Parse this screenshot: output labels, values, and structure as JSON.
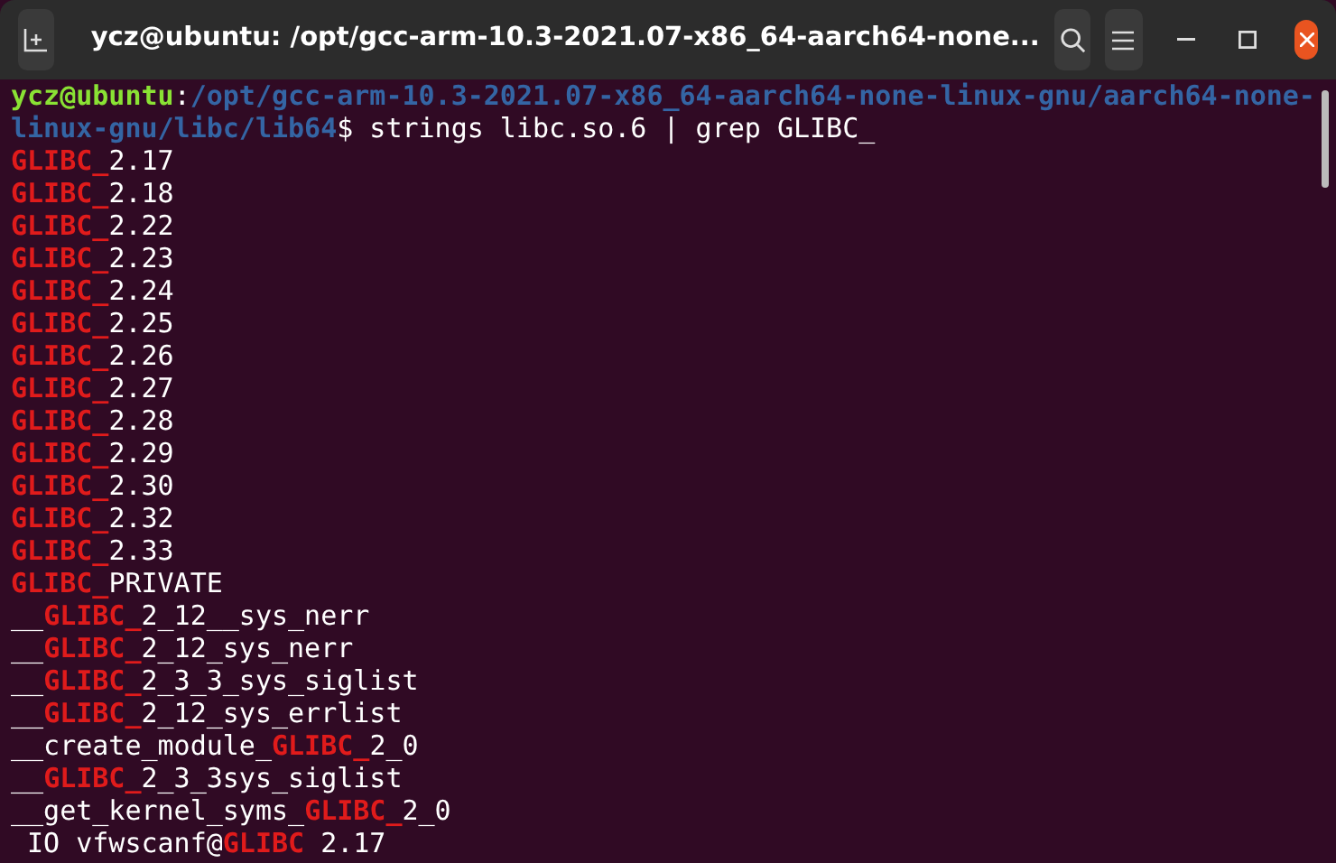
{
  "window": {
    "title": "ycz@ubuntu: /opt/gcc-arm-10.3-2021.07-x86_64-aarch64-none..."
  },
  "prompt": {
    "user_host": "ycz@ubuntu",
    "separator": ":",
    "path": "/opt/gcc-arm-10.3-2021.07-x86_64-aarch64-none-linux-gnu/aarch64-none-linux-gnu/libc/lib64",
    "symbol": "$",
    "command": " strings libc.so.6 | grep GLIBC_"
  },
  "output": [
    [
      {
        "text": "GLIBC_",
        "match": true
      },
      {
        "text": "2.17",
        "match": false
      }
    ],
    [
      {
        "text": "GLIBC_",
        "match": true
      },
      {
        "text": "2.18",
        "match": false
      }
    ],
    [
      {
        "text": "GLIBC_",
        "match": true
      },
      {
        "text": "2.22",
        "match": false
      }
    ],
    [
      {
        "text": "GLIBC_",
        "match": true
      },
      {
        "text": "2.23",
        "match": false
      }
    ],
    [
      {
        "text": "GLIBC_",
        "match": true
      },
      {
        "text": "2.24",
        "match": false
      }
    ],
    [
      {
        "text": "GLIBC_",
        "match": true
      },
      {
        "text": "2.25",
        "match": false
      }
    ],
    [
      {
        "text": "GLIBC_",
        "match": true
      },
      {
        "text": "2.26",
        "match": false
      }
    ],
    [
      {
        "text": "GLIBC_",
        "match": true
      },
      {
        "text": "2.27",
        "match": false
      }
    ],
    [
      {
        "text": "GLIBC_",
        "match": true
      },
      {
        "text": "2.28",
        "match": false
      }
    ],
    [
      {
        "text": "GLIBC_",
        "match": true
      },
      {
        "text": "2.29",
        "match": false
      }
    ],
    [
      {
        "text": "GLIBC_",
        "match": true
      },
      {
        "text": "2.30",
        "match": false
      }
    ],
    [
      {
        "text": "GLIBC_",
        "match": true
      },
      {
        "text": "2.32",
        "match": false
      }
    ],
    [
      {
        "text": "GLIBC_",
        "match": true
      },
      {
        "text": "2.33",
        "match": false
      }
    ],
    [
      {
        "text": "GLIBC_",
        "match": true
      },
      {
        "text": "PRIVATE",
        "match": false
      }
    ],
    [
      {
        "text": "__",
        "match": false
      },
      {
        "text": "GLIBC_",
        "match": true
      },
      {
        "text": "2_12__sys_nerr",
        "match": false
      }
    ],
    [
      {
        "text": "__",
        "match": false
      },
      {
        "text": "GLIBC_",
        "match": true
      },
      {
        "text": "2_12_sys_nerr",
        "match": false
      }
    ],
    [
      {
        "text": "__",
        "match": false
      },
      {
        "text": "GLIBC_",
        "match": true
      },
      {
        "text": "2_3_3_sys_siglist",
        "match": false
      }
    ],
    [
      {
        "text": "__",
        "match": false
      },
      {
        "text": "GLIBC_",
        "match": true
      },
      {
        "text": "2_12_sys_errlist",
        "match": false
      }
    ],
    [
      {
        "text": "__create_module_",
        "match": false
      },
      {
        "text": "GLIBC_",
        "match": true
      },
      {
        "text": "2_0",
        "match": false
      }
    ],
    [
      {
        "text": "__",
        "match": false
      },
      {
        "text": "GLIBC_",
        "match": true
      },
      {
        "text": "2_3_3sys_siglist",
        "match": false
      }
    ],
    [
      {
        "text": "__get_kernel_syms_",
        "match": false
      },
      {
        "text": "GLIBC_",
        "match": true
      },
      {
        "text": "2_0",
        "match": false
      }
    ],
    [
      {
        "text": " IO vfwscanf@",
        "match": false
      },
      {
        "text": "GLIBC",
        "match": true
      },
      {
        "text": " 2.17",
        "match": false
      }
    ]
  ]
}
